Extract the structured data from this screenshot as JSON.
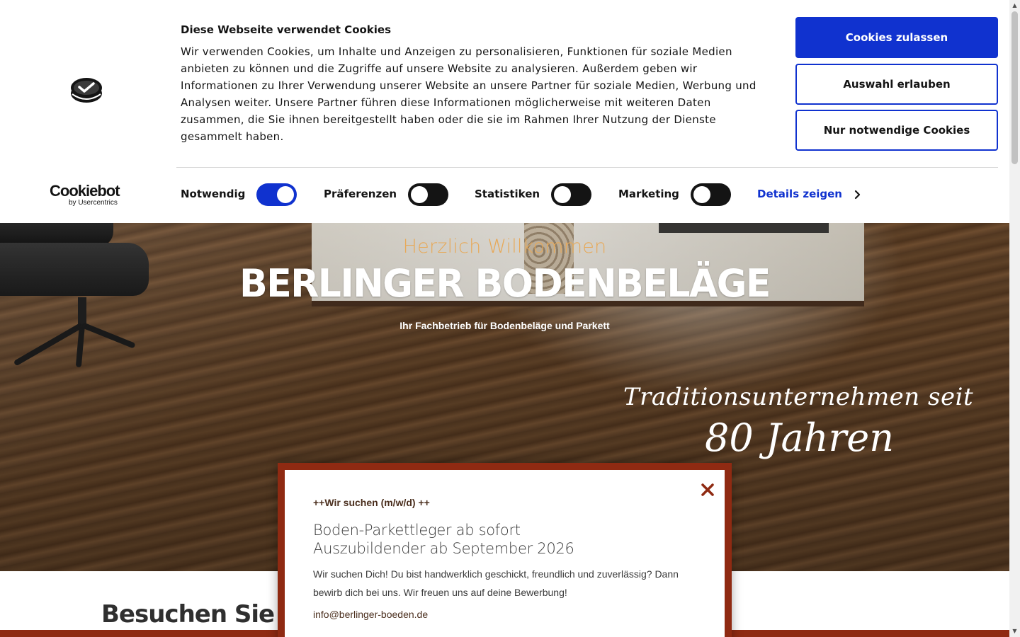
{
  "cookie_banner": {
    "title": "Diese Webseite verwendet Cookies",
    "text": "Wir verwenden Cookies, um Inhalte und Anzeigen zu personalisieren, Funktionen für soziale Medien anbieten zu können und die Zugriffe auf unsere Website zu analysieren. Außerdem geben wir Informationen zu Ihrer Verwendung unserer Website an unsere Partner für soziale Medien, Werbung und Analysen weiter. Unsere Partner führen diese Informationen möglicherweise mit weiteren Daten zusammen, die Sie ihnen bereitgestellt haben oder die sie im Rahmen Ihrer Nutzung der Dienste gesammelt haben.",
    "buttons": {
      "allow_all": "Cookies zulassen",
      "allow_selection": "Auswahl erlauben",
      "necessary_only": "Nur notwendige Cookies"
    },
    "brand": {
      "name": "Cookiebot",
      "by": "by Usercentrics"
    },
    "categories": [
      {
        "label": "Notwendig",
        "enabled": true
      },
      {
        "label": "Präferenzen",
        "enabled": false
      },
      {
        "label": "Statistiken",
        "enabled": false
      },
      {
        "label": "Marketing",
        "enabled": false
      }
    ],
    "details_link": "Details zeigen",
    "accent_color": "#1032cf"
  },
  "hero": {
    "welcome": "Herzlich Willkommen",
    "title": "BERLINGER BODENBELÄGE",
    "subtitle": "Ihr Fachbetrieb für Bodenbeläge und Parkett",
    "script_line1": "Traditionsunternehmen seit",
    "script_line2": "80 Jahren",
    "welcome_color": "#e7a959"
  },
  "section": {
    "heading": "Besuchen Sie un"
  },
  "job_popup": {
    "kicker": "++Wir suchen (m/w/d) ++",
    "title_line1": "Boden-Parkettleger ab sofort",
    "title_line2": "Auszubildender ab September 2026",
    "text": "Wir suchen Dich! Du bist handwerklich geschickt, freundlich und zuverlässig? Dann bewirb dich bei uns. Wir freuen uns auf deine Bewerbung!",
    "email": "info@berlinger-boeden.de",
    "border_color": "#8f2a12",
    "close_icon": "close-icon"
  }
}
